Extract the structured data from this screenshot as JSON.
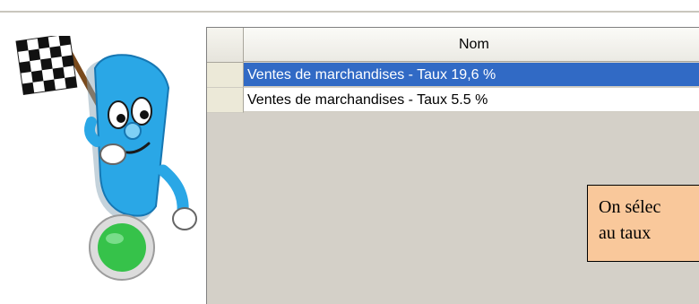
{
  "grid": {
    "column_header": "Nom",
    "rows": [
      {
        "label": "Ventes de marchandises - Taux 19,6 %",
        "selected": true
      },
      {
        "label": "Ventes de marchandises - Taux 5.5 %",
        "selected": false
      }
    ]
  },
  "callout": {
    "line1": "On sélec",
    "line2": "au taux"
  },
  "mascot": {
    "icon": "mascot-with-checkered-flag-icon",
    "colors": {
      "body": "#2aa7e6",
      "light": "#36c24a"
    }
  }
}
